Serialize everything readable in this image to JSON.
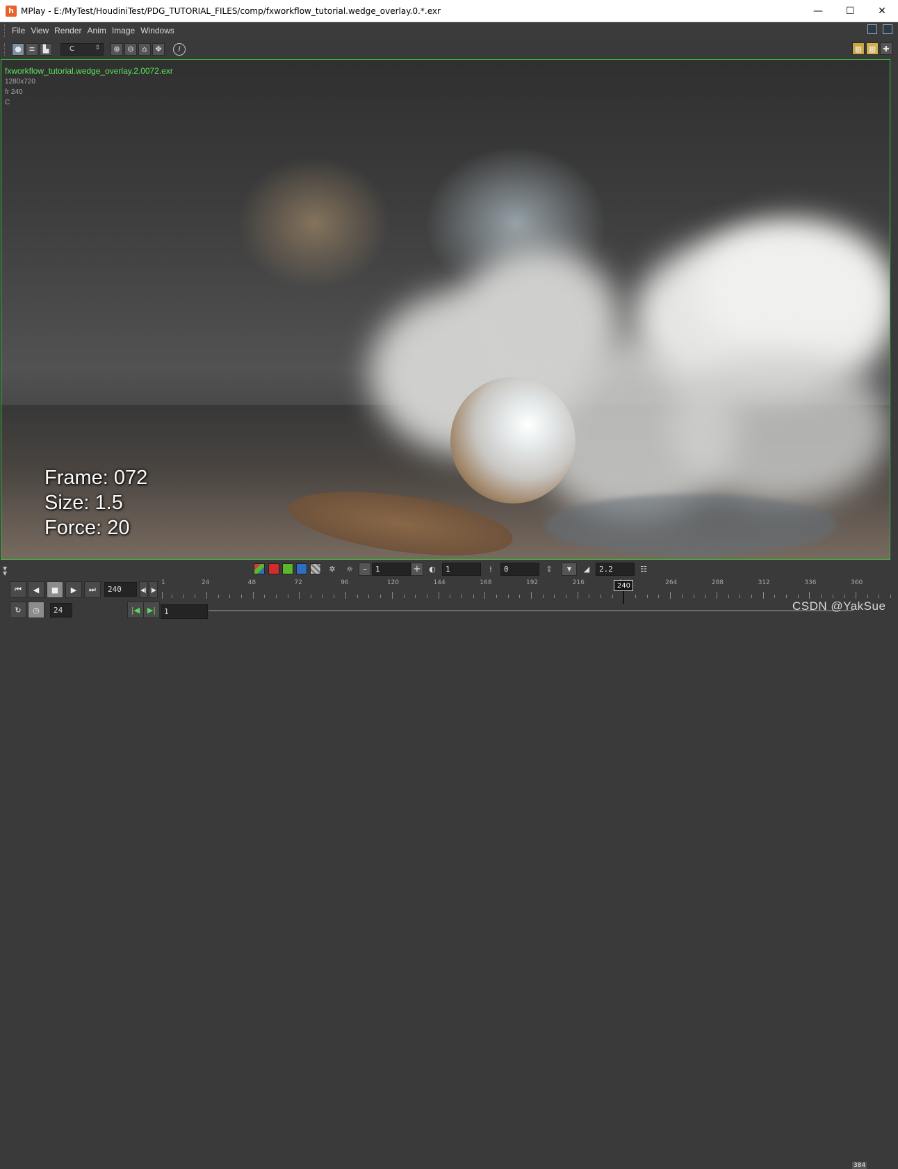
{
  "window": {
    "title": "MPlay - E:/MyTest/HoudiniTest/PDG_TUTORIAL_FILES/comp/fxworkflow_tutorial.wedge_overlay.0.*.exr",
    "app_icon": "houdini-icon",
    "controls": {
      "minimize": "—",
      "maximize": "☐",
      "close": "✕"
    }
  },
  "menu": {
    "items": [
      "File",
      "View",
      "Render",
      "Anim",
      "Image",
      "Windows"
    ]
  },
  "toolbar": {
    "channel": "C",
    "info_glyph": "i"
  },
  "viewport": {
    "filename": "fxworkflow_tutorial.wedge_overlay.2.0072.exr",
    "resolution": "1280x720",
    "frame_rate": "fr 240",
    "channel": "C",
    "overlay_lines": [
      "Frame: 072",
      "Size: 1.5",
      "Force: 20"
    ],
    "border_color": "#3cb83c",
    "filename_color": "#5ae65a"
  },
  "adjust_bar": {
    "swatch_colors": [
      "#c84040",
      "#d42b2b",
      "#5cb72a",
      "#2f6fbf",
      "#bdbdbd"
    ],
    "exposure_minus": "–",
    "exposure_value": "1",
    "exposure_plus": "+",
    "gamma_value": "1",
    "offset_value": "0",
    "lut_value": "2.2"
  },
  "playbar": {
    "current_frame_field": "240",
    "fps_field": "24",
    "start_frame_field": "1",
    "timeline": {
      "start": 1,
      "end": 384,
      "labels": [
        "1",
        "24",
        "48",
        "72",
        "96",
        "120",
        "144",
        "168",
        "192",
        "216",
        "240",
        "264",
        "288",
        "312",
        "336",
        "360"
      ],
      "current_frame": "240",
      "end_label": "384"
    }
  },
  "watermark": "CSDN @YakSue"
}
